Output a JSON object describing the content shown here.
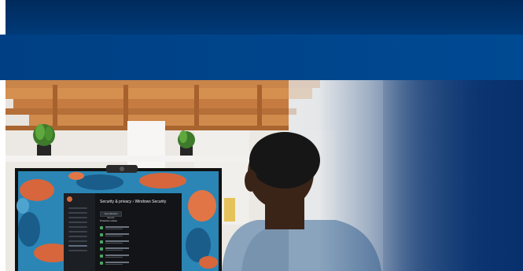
{
  "monitor_screen": {
    "title": "Security & privacy  ›  Windows Security",
    "button_label": "Open Windows Security",
    "section_heading": "Protection areas"
  },
  "colors": {
    "banner": "#003a78",
    "band": "#004a93"
  }
}
